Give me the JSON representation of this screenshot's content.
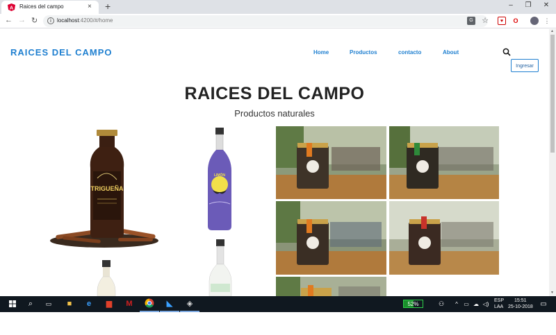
{
  "browser": {
    "tab_title": "Raices del campo",
    "tab_close": "×",
    "new_tab": "+",
    "url_host": "localhost",
    "url_rest": ":4200/#/home",
    "window_buttons": [
      "–",
      "❐",
      "✕"
    ]
  },
  "header": {
    "brand": "RAICES DEL CAMPO",
    "nav": [
      "Home",
      "Productos",
      "contacto",
      "About"
    ],
    "login_label": "Ingresar"
  },
  "hero": {
    "title": "RAICES DEL CAMPO",
    "subtitle": "Productos naturales"
  },
  "products": {
    "bottle1_label": "TRIGUEÑA",
    "bottle2_label": "LIMÓN"
  },
  "taskbar": {
    "battery": "52%",
    "battery_level": 0.52,
    "lang_top": "ESP",
    "lang_bottom": "LAA",
    "time": "15:51",
    "date": "25-10-2018"
  },
  "colors": {
    "accent": "#1e7fd0",
    "taskbar": "#101820"
  }
}
